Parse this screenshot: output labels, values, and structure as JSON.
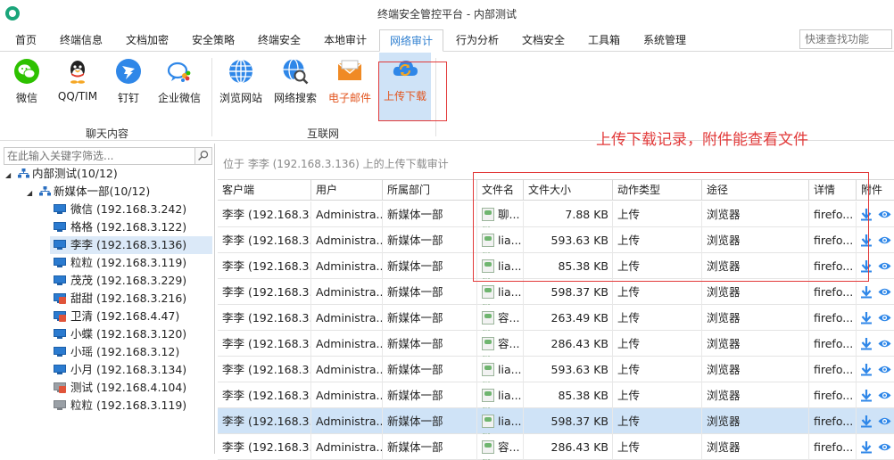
{
  "window": {
    "title": "终端安全管控平台 - 内部测试"
  },
  "menu": {
    "tabs": [
      "首页",
      "终端信息",
      "文档加密",
      "安全策略",
      "终端安全",
      "本地审计",
      "网络审计",
      "行为分析",
      "文档安全",
      "工具箱",
      "系统管理"
    ],
    "active_index": 6,
    "search_placeholder": "快速查找功能"
  },
  "ribbon": {
    "items": [
      {
        "label": "微信",
        "icon": "wechat-icon"
      },
      {
        "label": "QQ/TIM",
        "icon": "qq-icon"
      },
      {
        "label": "钉钉",
        "icon": "dingtalk-icon"
      },
      {
        "label": "企业微信",
        "icon": "wecom-icon"
      },
      {
        "label": "浏览网站",
        "icon": "globe-icon"
      },
      {
        "label": "网络搜索",
        "icon": "globe-search-icon"
      },
      {
        "label": "电子邮件",
        "icon": "mail-icon"
      },
      {
        "label": "上传下载",
        "icon": "cloud-sync-icon"
      }
    ],
    "selected_index": 7,
    "groups": [
      "聊天内容",
      "互联网"
    ]
  },
  "annotation": {
    "text": "上传下载记录，附件能查看文件",
    "color": "#e23a3a"
  },
  "tree": {
    "filter_placeholder": "在此输入关键字筛选...",
    "root": "内部测试(10/12)",
    "group": "新媒体一部(10/12)",
    "nodes": [
      {
        "label": "微信 (192.168.3.242)",
        "status": "online"
      },
      {
        "label": "格格 (192.168.3.122)",
        "status": "online"
      },
      {
        "label": "李李 (192.168.3.136)",
        "status": "online",
        "selected": true
      },
      {
        "label": "粒粒 (192.168.3.119)",
        "status": "online"
      },
      {
        "label": "茂茂 (192.168.3.229)",
        "status": "online"
      },
      {
        "label": "甜甜 (192.168.3.216)",
        "status": "alert"
      },
      {
        "label": "卫清 (192.168.4.47)",
        "status": "alert"
      },
      {
        "label": "小蝶 (192.168.3.120)",
        "status": "online"
      },
      {
        "label": "小瑶 (192.168.3.12)",
        "status": "online"
      },
      {
        "label": "小月 (192.168.3.134)",
        "status": "online"
      },
      {
        "label": "测试 (192.168.4.104)",
        "status": "offline-alert"
      },
      {
        "label": "粒粒 (192.168.3.119)",
        "status": "offline"
      }
    ]
  },
  "main": {
    "location": "位于 李李 (192.168.3.136) 上的上传下载审计",
    "columns": [
      "客户端",
      "用户",
      "所属部门",
      "文件名",
      "文件大小",
      "动作类型",
      "途径",
      "详情",
      "附件"
    ],
    "rows": [
      {
        "client": "李李 (192.168.3...",
        "user": "Administra...",
        "dept": "新媒体一部",
        "file": "聊...",
        "size": "7.88 KB",
        "action": "上传",
        "via": "浏览器",
        "detail": "firefo..."
      },
      {
        "client": "李李 (192.168.3...",
        "user": "Administra...",
        "dept": "新媒体一部",
        "file": "lia...",
        "size": "593.63 KB",
        "action": "上传",
        "via": "浏览器",
        "detail": "firefo..."
      },
      {
        "client": "李李 (192.168.3...",
        "user": "Administra...",
        "dept": "新媒体一部",
        "file": "lia...",
        "size": "85.38 KB",
        "action": "上传",
        "via": "浏览器",
        "detail": "firefo..."
      },
      {
        "client": "李李 (192.168.3...",
        "user": "Administra...",
        "dept": "新媒体一部",
        "file": "lia...",
        "size": "598.37 KB",
        "action": "上传",
        "via": "浏览器",
        "detail": "firefo..."
      },
      {
        "client": "李李 (192.168.3...",
        "user": "Administra...",
        "dept": "新媒体一部",
        "file": "容...",
        "size": "263.49 KB",
        "action": "上传",
        "via": "浏览器",
        "detail": "firefo..."
      },
      {
        "client": "李李 (192.168.3...",
        "user": "Administra...",
        "dept": "新媒体一部",
        "file": "容...",
        "size": "286.43 KB",
        "action": "上传",
        "via": "浏览器",
        "detail": "firefo..."
      },
      {
        "client": "李李 (192.168.3...",
        "user": "Administra...",
        "dept": "新媒体一部",
        "file": "lia...",
        "size": "593.63 KB",
        "action": "上传",
        "via": "浏览器",
        "detail": "firefo..."
      },
      {
        "client": "李李 (192.168.3...",
        "user": "Administra...",
        "dept": "新媒体一部",
        "file": "lia...",
        "size": "85.38 KB",
        "action": "上传",
        "via": "浏览器",
        "detail": "firefo..."
      },
      {
        "client": "李李 (192.168.3...",
        "user": "Administra...",
        "dept": "新媒体一部",
        "file": "lia...",
        "size": "598.37 KB",
        "action": "上传",
        "via": "浏览器",
        "detail": "firefo...",
        "selected": true
      },
      {
        "client": "李李 (192.168.3...",
        "user": "Administra...",
        "dept": "新媒体一部",
        "file": "容...",
        "size": "286.43 KB",
        "action": "上传",
        "via": "浏览器",
        "detail": "firefo..."
      }
    ]
  },
  "colors": {
    "accent": "#2f7fd0",
    "selection": "#cfe3f7",
    "highlight_text": "#e2541e"
  }
}
